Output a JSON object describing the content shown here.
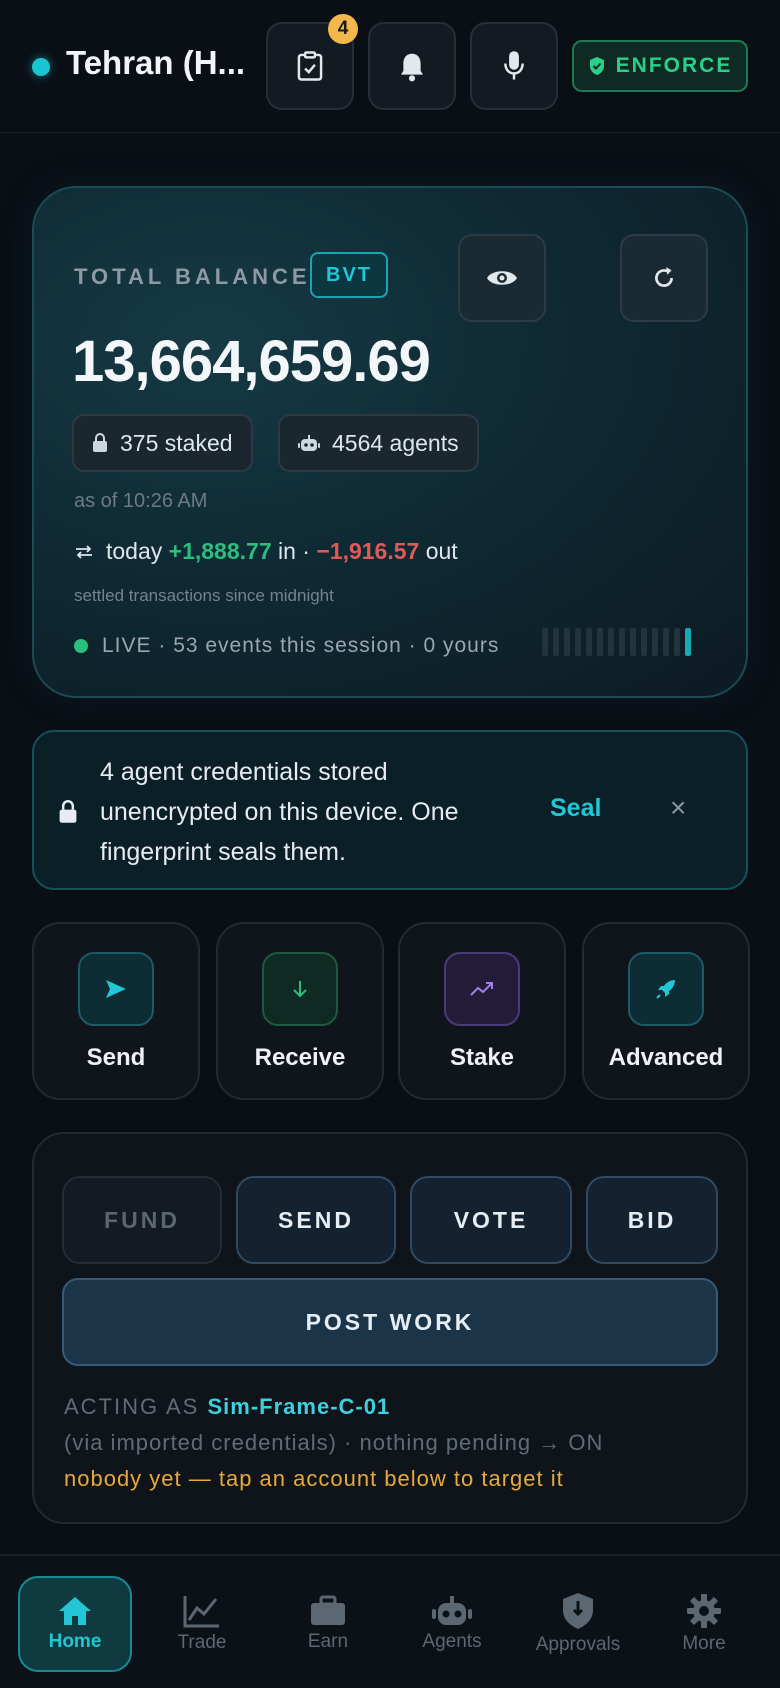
{
  "header": {
    "city": "Tehran (H...",
    "tasks_badge": "4",
    "enforce_label": "ENFORCE"
  },
  "balance": {
    "label": "TOTAL BALANCE",
    "currency": "BVT",
    "amount": "13,664,659.69",
    "staked": "375 staked",
    "agents": "4564 agents",
    "as_of": "as of 10:26 AM",
    "today_prefix": "today",
    "in_value": "+1,888.77",
    "in_label": "in ·",
    "out_value": "−1,916.57",
    "out_label": "out",
    "settled_note": "settled transactions since midnight",
    "live_text": "LIVE · 53 events this session · 0 yours",
    "activity_level": 0.07
  },
  "credentials_banner": {
    "message": "4 agent credentials stored unencrypted on this device. One fingerprint seals them.",
    "seal_label": "Seal",
    "close_glyph": "×"
  },
  "actions": [
    {
      "label": "Send",
      "icon": "send-icon"
    },
    {
      "label": "Receive",
      "icon": "arrow-down-icon"
    },
    {
      "label": "Stake",
      "icon": "trending-up-icon"
    },
    {
      "label": "Advanced",
      "icon": "rocket-icon"
    }
  ],
  "ops": {
    "fund": "FUND",
    "send": "SEND",
    "vote": "VOTE",
    "bid": "BID",
    "post_work": "POST WORK",
    "acting_as_label": "ACTING AS",
    "acting_as_name": "Sim-Frame-C-01",
    "via_text": "(via imported credentials) · nothing pending → ON",
    "nobody_text": "nobody yet — tap an account below to target it"
  },
  "nav": [
    {
      "label": "Home",
      "icon": "home-icon",
      "active": true
    },
    {
      "label": "Trade",
      "icon": "chart-line-icon"
    },
    {
      "label": "Earn",
      "icon": "briefcase-icon"
    },
    {
      "label": "Agents",
      "icon": "robot-icon"
    },
    {
      "label": "Approvals",
      "icon": "shield-icon"
    },
    {
      "label": "More",
      "icon": "gear-icon"
    }
  ],
  "colors": {
    "accent": "#22c6d4",
    "positive": "#2bbf7d",
    "negative": "#e05a5a",
    "warning": "#e6a93a",
    "badge": "#f2b84b"
  }
}
